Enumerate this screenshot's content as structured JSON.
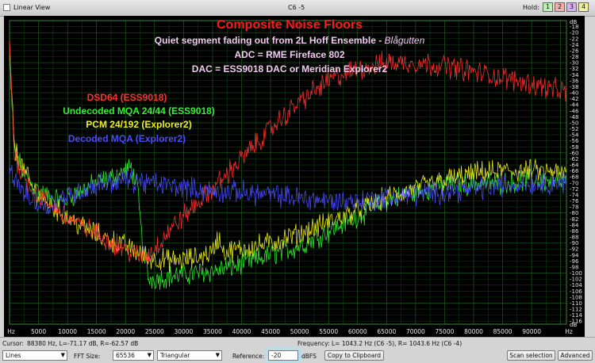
{
  "titlebar": {
    "view_label": "Linear View",
    "channel_label": "C6 -5",
    "hold_label": "Hold:",
    "hold_buttons": [
      {
        "label": "1",
        "color": "#b8f0b0"
      },
      {
        "label": "2",
        "color": "#f0b0b0"
      },
      {
        "label": "3",
        "color": "#d8b0f0"
      },
      {
        "label": "4",
        "color": "#f0f0a0"
      }
    ]
  },
  "overlay": {
    "title": "Composite Noise Floors",
    "line1_prefix": "Quiet segment fading out from 2L Hoff Ensemble - ",
    "line1_italic": "Blågutten",
    "line2": "ADC = RME Fireface 802",
    "line3": "DAC = ESS9018 DAC or Meridian Explorer2",
    "colors": {
      "title": "#ff1a1a",
      "subtitle": "#f3c8f3"
    }
  },
  "chart_data": {
    "type": "line",
    "xlabel_ticks": [
      "Hz",
      "5000",
      "10000",
      "15000",
      "20000",
      "25000",
      "30000",
      "35000",
      "40000",
      "45000",
      "50000",
      "55000",
      "60000",
      "65000",
      "70000",
      "75000",
      "80000",
      "85000",
      "90000",
      "Hz"
    ],
    "ylabel_ticks": [
      "dB",
      "-18",
      "-20",
      "-22",
      "-24",
      "-26",
      "-28",
      "-30",
      "-32",
      "-34",
      "-36",
      "-38",
      "-40",
      "-42",
      "-44",
      "-46",
      "-48",
      "-50",
      "-52",
      "-54",
      "-56",
      "-58",
      "-60",
      "-62",
      "-64",
      "-66",
      "-68",
      "-70",
      "-72",
      "-74",
      "-76",
      "-78",
      "-80",
      "-82",
      "-84",
      "-86",
      "-88",
      "-90",
      "-92",
      "-94",
      "-96",
      "-98",
      "-100",
      "-102",
      "-104",
      "-106",
      "-108",
      "-110",
      "-112",
      "-114",
      "-116",
      "dB"
    ],
    "xlim": [
      0,
      96000
    ],
    "ylim": [
      -117,
      -16
    ],
    "grid": true,
    "legend_position": "upper-left",
    "series": [
      {
        "name": "DSD64 (ESS9018)",
        "color": "#ff3030",
        "points": [
          [
            0,
            -22
          ],
          [
            800,
            -60
          ],
          [
            2000,
            -66
          ],
          [
            4000,
            -72
          ],
          [
            6000,
            -76
          ],
          [
            9000,
            -80
          ],
          [
            12000,
            -84
          ],
          [
            16000,
            -88
          ],
          [
            20000,
            -92
          ],
          [
            23000,
            -95
          ],
          [
            25000,
            -92
          ],
          [
            27000,
            -87
          ],
          [
            30000,
            -81
          ],
          [
            35000,
            -72
          ],
          [
            40000,
            -62
          ],
          [
            45000,
            -52
          ],
          [
            50000,
            -43
          ],
          [
            55000,
            -36
          ],
          [
            60000,
            -32
          ],
          [
            65000,
            -30
          ],
          [
            70000,
            -30
          ],
          [
            75000,
            -31
          ],
          [
            80000,
            -33
          ],
          [
            85000,
            -35
          ],
          [
            90000,
            -37
          ],
          [
            96000,
            -40
          ]
        ]
      },
      {
        "name": "Undecoded MQA 24/44 (ESS9018)",
        "color": "#33ee33",
        "points": [
          [
            0,
            -28
          ],
          [
            800,
            -58
          ],
          [
            2000,
            -65
          ],
          [
            4000,
            -71
          ],
          [
            6000,
            -74
          ],
          [
            9000,
            -76
          ],
          [
            12000,
            -73
          ],
          [
            15000,
            -70
          ],
          [
            18000,
            -68
          ],
          [
            20000,
            -66
          ],
          [
            21000,
            -65
          ],
          [
            22000,
            -71
          ],
          [
            23000,
            -92
          ],
          [
            24000,
            -102
          ],
          [
            28000,
            -101
          ],
          [
            32000,
            -100
          ],
          [
            36000,
            -99
          ],
          [
            40000,
            -97
          ],
          [
            45000,
            -94
          ],
          [
            50000,
            -91
          ],
          [
            55000,
            -86
          ],
          [
            60000,
            -81
          ],
          [
            65000,
            -76
          ],
          [
            70000,
            -73
          ],
          [
            75000,
            -71
          ],
          [
            80000,
            -70
          ],
          [
            85000,
            -70
          ],
          [
            90000,
            -69
          ],
          [
            96000,
            -70
          ]
        ]
      },
      {
        "name": "PCM 24/192 (Explorer2)",
        "color": "#f0f020",
        "points": [
          [
            0,
            -25
          ],
          [
            800,
            -58
          ],
          [
            2000,
            -64
          ],
          [
            4000,
            -72
          ],
          [
            6000,
            -76
          ],
          [
            9000,
            -80
          ],
          [
            12000,
            -84
          ],
          [
            16000,
            -88
          ],
          [
            20000,
            -91
          ],
          [
            24000,
            -95
          ],
          [
            28000,
            -96
          ],
          [
            32000,
            -95
          ],
          [
            35000,
            -93
          ],
          [
            36000,
            -88
          ],
          [
            37000,
            -93
          ],
          [
            40000,
            -92
          ],
          [
            45000,
            -90
          ],
          [
            50000,
            -87
          ],
          [
            55000,
            -83
          ],
          [
            60000,
            -79
          ],
          [
            65000,
            -75
          ],
          [
            70000,
            -72
          ],
          [
            75000,
            -69
          ],
          [
            80000,
            -67
          ],
          [
            85000,
            -66
          ],
          [
            90000,
            -66
          ],
          [
            96000,
            -67
          ]
        ]
      },
      {
        "name": "Decoded MQA (Explorer2)",
        "color": "#4a4aff",
        "points": [
          [
            0,
            -66
          ],
          [
            2000,
            -72
          ],
          [
            4000,
            -76
          ],
          [
            6000,
            -78
          ],
          [
            9000,
            -75
          ],
          [
            12000,
            -73
          ],
          [
            16000,
            -70
          ],
          [
            20000,
            -69
          ],
          [
            24000,
            -70
          ],
          [
            28000,
            -71
          ],
          [
            32000,
            -72
          ],
          [
            36000,
            -73
          ],
          [
            40000,
            -73
          ],
          [
            45000,
            -74
          ],
          [
            50000,
            -75
          ],
          [
            55000,
            -76
          ],
          [
            60000,
            -76
          ],
          [
            65000,
            -75
          ],
          [
            70000,
            -74
          ],
          [
            75000,
            -73
          ],
          [
            80000,
            -72
          ],
          [
            85000,
            -71
          ],
          [
            90000,
            -70
          ],
          [
            96000,
            -70
          ]
        ]
      }
    ]
  },
  "status": {
    "cursor_text": "Cursor:",
    "cursor_value": "88380 Hz, L=-71.17 dB, R=-62.57 dB",
    "frequency_label": "Frequency:",
    "frequency_value": "L= 1043.2 Hz (C6 -5), R= 1043.6 Hz (C6 -4)",
    "draw_mode": "Lines",
    "fft_label": "FFT Size:",
    "fft_size": "65536",
    "window": "Triangular",
    "reference_label": "Reference:",
    "reference_value": "-20",
    "reference_unit": "dBFS",
    "copy_button": "Copy to Clipboard",
    "scan_button": "Scan selection",
    "advanced_button": "Advanced"
  }
}
